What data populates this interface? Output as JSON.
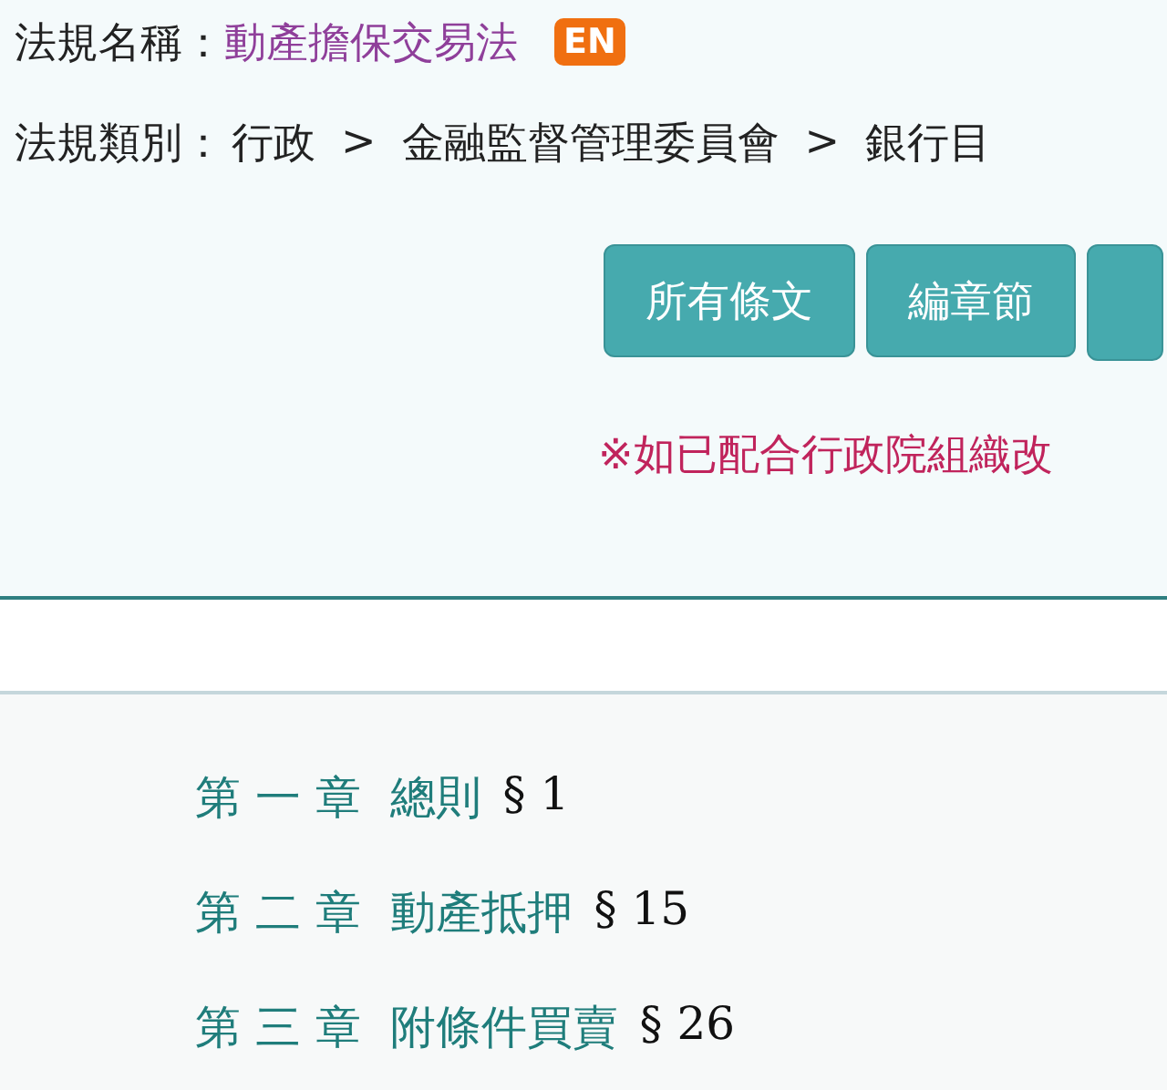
{
  "law_name": {
    "label": "法規名稱：",
    "value": "動產擔保交易法",
    "badge": "EN"
  },
  "law_category": {
    "label": "法規類別：",
    "path": [
      "行政",
      "金融監督管理委員會",
      "銀行目"
    ],
    "separator": ">"
  },
  "buttons": [
    "所有條文",
    "編章節"
  ],
  "notice": "※如已配合行政院組織改",
  "chapters": [
    {
      "number": "第 一 章",
      "title": "總則",
      "section": "§ 1"
    },
    {
      "number": "第 二 章",
      "title": "動產抵押",
      "section": "§ 15"
    },
    {
      "number": "第 三 章",
      "title": "附條件買賣",
      "section": "§ 26"
    }
  ]
}
